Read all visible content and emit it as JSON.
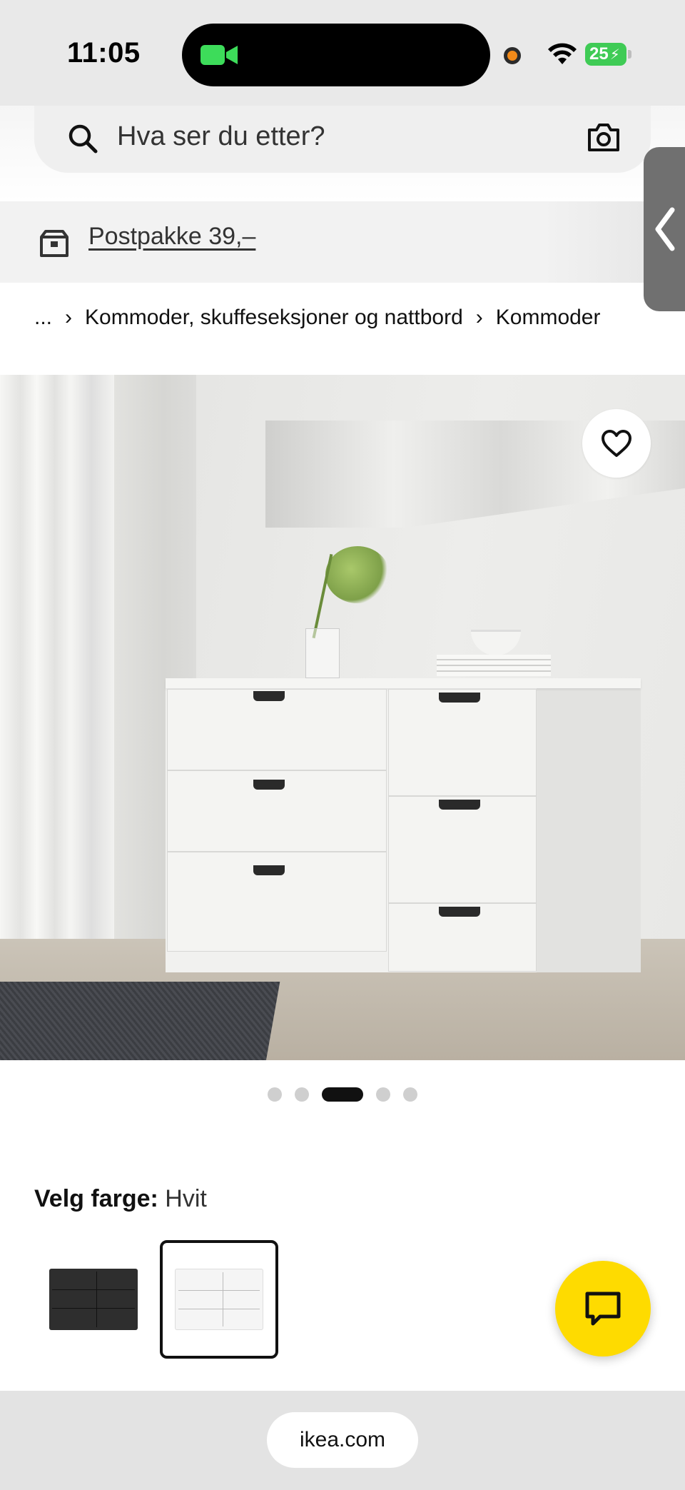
{
  "status_bar": {
    "time": "11:05",
    "battery": "25",
    "icons": [
      "facetime-camera-icon",
      "orange-mic-indicator",
      "wifi-icon",
      "battery-charging-icon"
    ]
  },
  "search": {
    "placeholder": "Hva ser du etter?",
    "icons": [
      "search-icon",
      "camera-icon"
    ]
  },
  "shipping": {
    "label": "Postpakke 39,–",
    "icon": "box-icon"
  },
  "side_tab": {
    "icon": "chevron-left-icon"
  },
  "breadcrumb": {
    "ellipsis": "...",
    "items": [
      "Kommoder, skuffeseksjoner og nattbord",
      "Kommoder"
    ],
    "separator": "›"
  },
  "product_image": {
    "description_icon": "heart-icon",
    "carousel": {
      "count": 5,
      "active_index": 2
    }
  },
  "color_selector": {
    "label": "Velg farge:",
    "selected": "Hvit",
    "options": [
      {
        "name": "black-dresser-swatch",
        "color": "#2e2e2e",
        "selected": false
      },
      {
        "name": "white-dresser-swatch",
        "color": "#f5f5f5",
        "selected": true
      }
    ]
  },
  "chat": {
    "icon": "chat-icon",
    "color": "#fedb00"
  },
  "browser": {
    "url": "ikea.com"
  }
}
